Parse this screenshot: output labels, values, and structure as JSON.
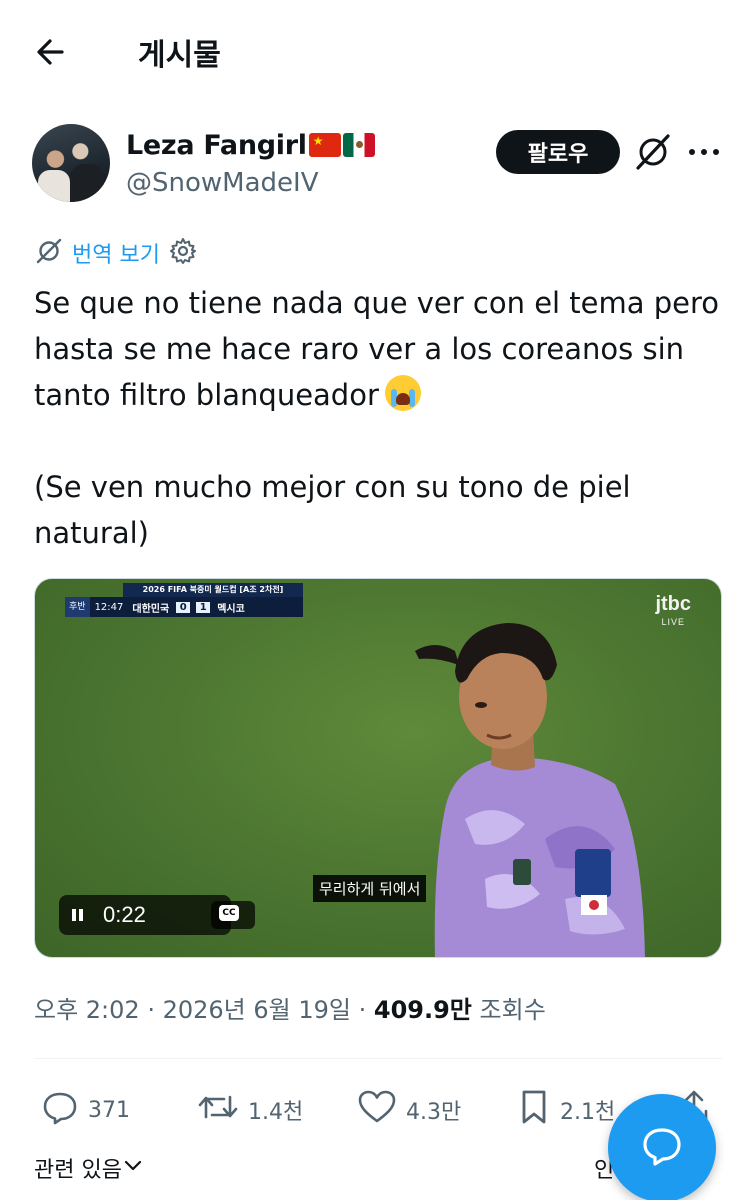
{
  "header": {
    "title": "게시물"
  },
  "author": {
    "name": "Leza Fangirl",
    "handle": "@SnowMadeIV",
    "follow_label": "팔로우",
    "flags": [
      "cn-flag-icon",
      "mx-flag-icon"
    ]
  },
  "translate": {
    "label": "번역 보기"
  },
  "post": {
    "paragraph1": "Se que no tiene nada que ver con el tema pero hasta se me hace raro ver a los coreanos sin tanto filtro blanqueador",
    "paragraph2": "(Se ven mucho mejor con su tono de piel natural)"
  },
  "video": {
    "scoreboard": {
      "title": "2026 FIFA 북중미 월드컵 [A조 2차전]",
      "half": "후반",
      "clock": "12:47",
      "home": "대한민국",
      "home_score": "0",
      "away_score": "1",
      "away": "멕시코"
    },
    "broadcaster": "jtbc",
    "broadcaster_sub": "LIVE",
    "subtitle": "무리하게 뒤에서",
    "time": "0:22",
    "cc_label": "CC"
  },
  "meta": {
    "time": "오후 2:02",
    "date": "2026년 6월 19일",
    "views": "409.9만",
    "views_label": "조회수"
  },
  "actions": {
    "replies": "371",
    "reposts": "1.4천",
    "likes": "4.3만",
    "bookmarks": "2.1천"
  },
  "related": {
    "label": "관련 있음",
    "right_label": "인"
  },
  "colors": {
    "accent": "#1d9bf0",
    "text": "#0f1419",
    "muted": "#536471"
  }
}
